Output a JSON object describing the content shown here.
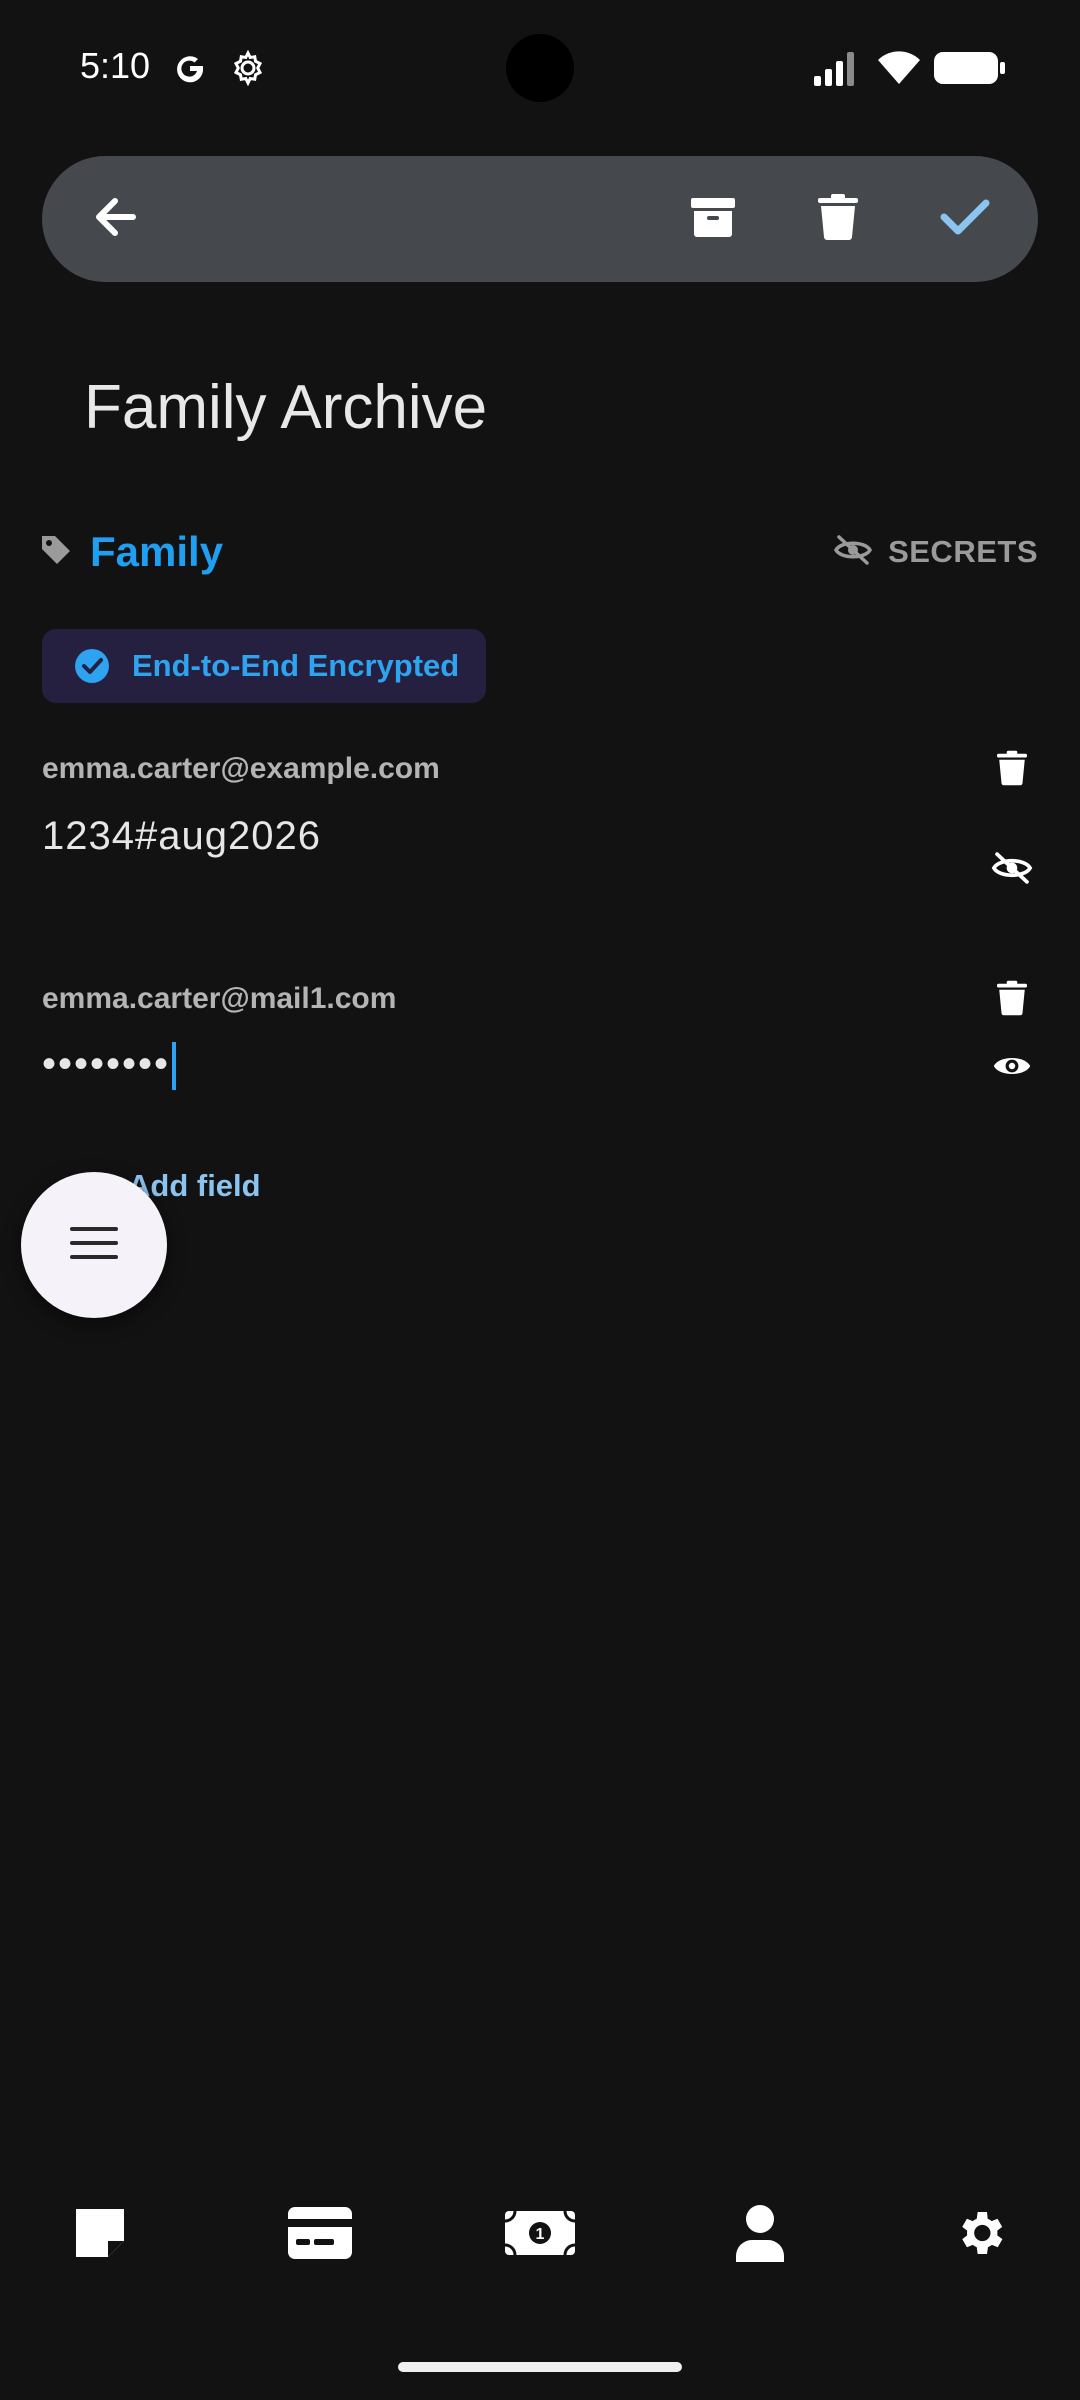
{
  "status_bar": {
    "time": "5:10",
    "icons": [
      "google-icon",
      "settings-gear-icon",
      "signal-icon",
      "wifi-icon",
      "battery-icon"
    ]
  },
  "toolbar": {
    "icons": [
      "back-arrow-icon",
      "archive-icon",
      "trash-icon",
      "check-icon"
    ],
    "accent_color": "#8cc4f0"
  },
  "note": {
    "title": "Family Archive",
    "tag": "Family",
    "secrets_label": "SECRETS",
    "encryption_badge": "End-to-End Encrypted"
  },
  "fields": [
    {
      "label": "emma.carter@example.com",
      "value": "1234#aug2026",
      "visible": true
    },
    {
      "label": "emma.carter@mail1.com",
      "value": "••••••••",
      "visible": false
    }
  ],
  "add_field_label": "Add field",
  "bottom_nav": {
    "items": [
      "note-icon",
      "credit-card-icon",
      "money-bill-icon",
      "person-icon",
      "settings-gear-icon"
    ]
  },
  "colors": {
    "background": "#121212",
    "accent": "#1e9ff2",
    "toolbar": "#45484d",
    "badge_bg": "#262040"
  }
}
